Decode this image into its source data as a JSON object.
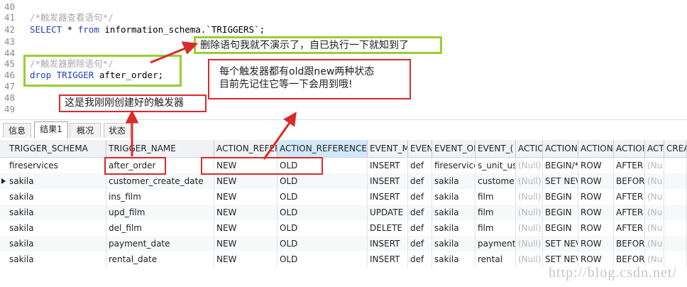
{
  "editor": {
    "lines": [
      {
        "no": "40",
        "code": "",
        "kind": "text"
      },
      {
        "no": "41",
        "code": "/*触发器查看语句*/",
        "kind": "comment"
      },
      {
        "no": "42",
        "code": "",
        "kind": "select"
      },
      {
        "no": "43",
        "code": "",
        "kind": "text"
      },
      {
        "no": "44",
        "code": "",
        "kind": "text"
      },
      {
        "no": "45",
        "code": "/*触发器删除语句*/",
        "kind": "comment"
      },
      {
        "no": "46",
        "code": "",
        "kind": "drop"
      },
      {
        "no": "47",
        "code": "",
        "kind": "text"
      },
      {
        "no": "48",
        "code": "",
        "kind": "text"
      },
      {
        "no": "49",
        "code": "",
        "kind": "text"
      }
    ],
    "select_stmt": {
      "kw1": "SELECT",
      "mid1": " * ",
      "kw2": "from",
      "rest": " information_schema.`TRIGGERS`;"
    },
    "drop_stmt": {
      "kw1": "drop",
      "mid1": " ",
      "kw2": "TRIGGER",
      "rest": " after_order;"
    }
  },
  "annotations": {
    "delete_note": "删除语句我就不演示了，自已执行一下就知到了",
    "state_note_line1": "每个触发器都有old跟new两种状态",
    "state_note_line2": "目前先记住它等一下会用到哦!",
    "created_note": "这是我刚刚创建好的触发器",
    "green_color": "#9acd32",
    "red_color": "#d92b2b"
  },
  "tabs": [
    {
      "label": "信息",
      "active": false
    },
    {
      "label": "结果1",
      "active": true
    },
    {
      "label": "概况",
      "active": false
    },
    {
      "label": "状态",
      "active": false
    }
  ],
  "grid": {
    "headers": [
      "TRIGGER_SCHEMA",
      "TRIGGER_NAME",
      "ACTION_REFER",
      "ACTION_REFERENCE_",
      "EVENT_M",
      "EVEN",
      "EVENT_OI",
      "EVENT_(",
      "ACTIC",
      "ACTION",
      "ACTION",
      "ACTIOI",
      "ACT",
      "CREA"
    ],
    "rows": [
      [
        "fireservices",
        "after_order",
        "NEW",
        "OLD",
        "INSERT",
        "def",
        "fireservice",
        "s_unit_us",
        "(Null)",
        "BEGIN/*",
        "ROW",
        "AFTER",
        "(Nu",
        ""
      ],
      [
        "sakila",
        "customer_create_date",
        "NEW",
        "OLD",
        "INSERT",
        "def",
        "sakila",
        "custome",
        "(Null)",
        "SET NEV",
        "ROW",
        "BEFORI",
        "(Nu",
        ""
      ],
      [
        "sakila",
        "ins_film",
        "NEW",
        "OLD",
        "INSERT",
        "def",
        "sakila",
        "film",
        "(Null)",
        "BEGIN",
        "ROW",
        "AFTER",
        "(Nu",
        ""
      ],
      [
        "sakila",
        "upd_film",
        "NEW",
        "OLD",
        "UPDATE",
        "def",
        "sakila",
        "film",
        "(Null)",
        "BEGIN",
        "ROW",
        "AFTER",
        "(Nu",
        ""
      ],
      [
        "sakila",
        "del_film",
        "NEW",
        "OLD",
        "DELETE",
        "def",
        "sakila",
        "film",
        "(Null)",
        "BEGIN",
        "ROW",
        "AFTER",
        "(Nu",
        ""
      ],
      [
        "sakila",
        "payment_date",
        "NEW",
        "OLD",
        "INSERT",
        "def",
        "sakila",
        "payment",
        "(Null)",
        "SET NEV",
        "ROW",
        "BEFORI",
        "(Nu",
        ""
      ],
      [
        "sakila",
        "rental_date",
        "NEW",
        "OLD",
        "INSERT",
        "def",
        "sakila",
        "rental",
        "(Null)",
        "SET NEV",
        "ROW",
        "BEFORI",
        "(Nu",
        ""
      ]
    ],
    "selected_row_index": 1,
    "highlighted_header_index": 3
  },
  "watermark": "http://blog.csdn.net/"
}
